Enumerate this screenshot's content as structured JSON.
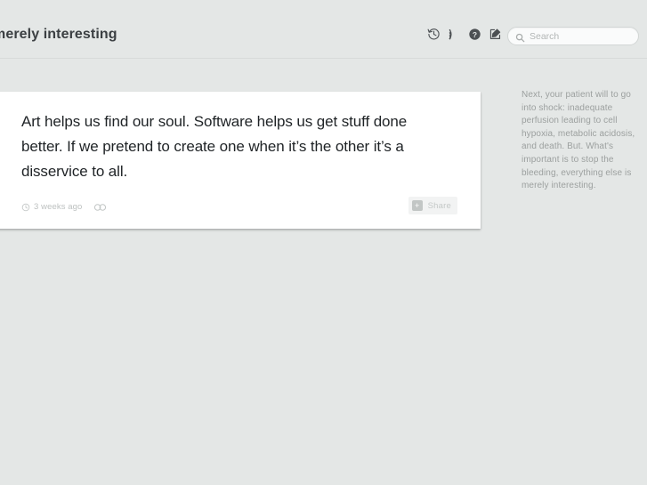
{
  "header": {
    "blog_title": "merely interesting",
    "icons": [
      {
        "name": "history-icon",
        "label": "History"
      },
      {
        "name": "rss-icon",
        "label": "RSS"
      },
      {
        "name": "help-icon",
        "label": "Help"
      },
      {
        "name": "compose-icon",
        "label": "Compose"
      }
    ],
    "search": {
      "placeholder": "Search",
      "value": "",
      "icon": "search-icon"
    }
  },
  "post": {
    "body": "Art helps us find our soul. Software helps us get stuff done better. If we pretend to create one when it’s the other it’s a disservice to all.",
    "timestamp": "3 weeks ago",
    "clock_icon": "clock-icon",
    "link_icon": "link-icon",
    "share": {
      "label": "Share",
      "glyph": "+"
    }
  },
  "sidebar": {
    "description": "Next, your patient will to go into shock: inadequate perfusion leading to cell hypoxia, metabolic acidosis, and death. But. What's important is to stop the bleeding, everything else is merely interesting."
  },
  "colors": {
    "page_background": "#e4e7e6",
    "card_background": "#ffffff",
    "text_primary": "#1f2326",
    "text_muted": "#9ca09f",
    "icon": "#4c5053"
  }
}
